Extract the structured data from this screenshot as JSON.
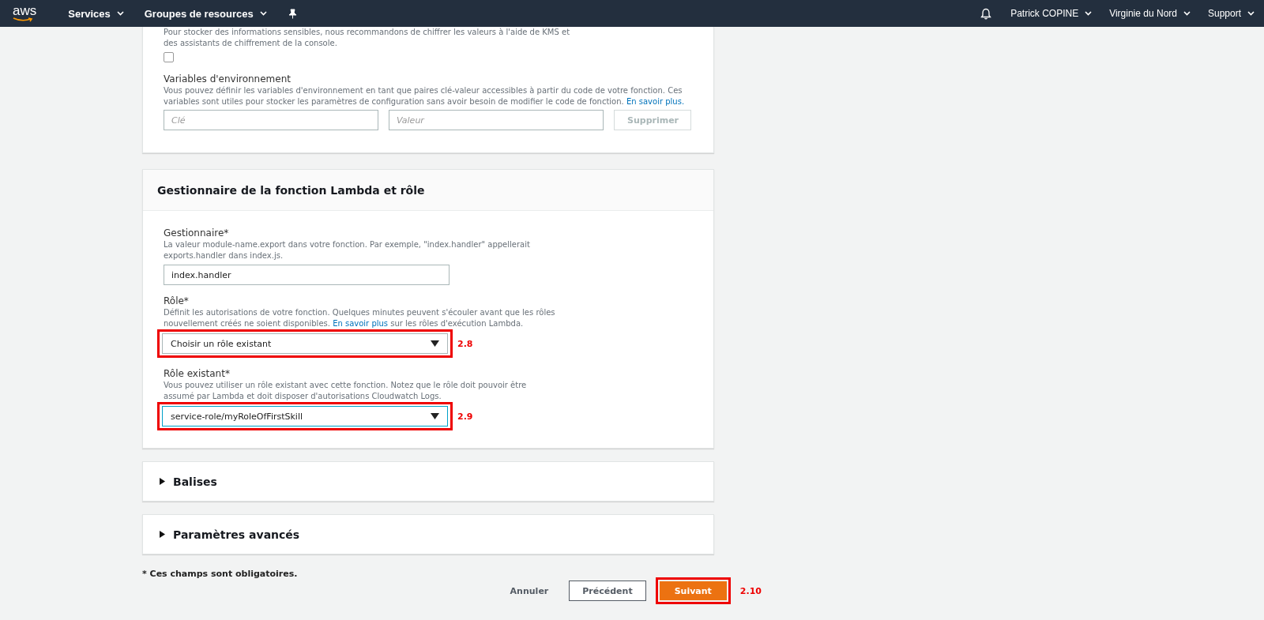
{
  "navbar": {
    "logo": "aws",
    "left_items": [
      {
        "label": "Services",
        "dropdown": true
      },
      {
        "label": "Groupes de resources",
        "dropdown": true
      }
    ],
    "right_items": [
      {
        "label": "Patrick COPINE",
        "dropdown": true
      },
      {
        "label": "Virginie du Nord",
        "dropdown": true
      },
      {
        "label": "Support",
        "dropdown": true
      }
    ]
  },
  "environment_card": {
    "encryption_note": [
      "Pour stocker des informations sensibles, nous recommandons de chiffrer les valeurs à l'aide de KMS et",
      "des assistants de chiffrement de la console."
    ],
    "encryption_checkbox": {
      "checked": false
    },
    "title": "Variables d'environnement",
    "description": "Vous pouvez définir les variables d'environnement en tant que paires clé-valeur accessibles à partir du code de votre fonction. Ces variables sont utiles pour stocker les paramètres de configuration sans avoir besoin de modifier le code de fonction.",
    "link": "En savoir plus.",
    "key_field": {
      "placeholder": "Clé"
    },
    "value_field": {
      "placeholder": "Valeur"
    },
    "delete_button": {
      "label": "Supprimer",
      "disabled": true
    }
  },
  "handler_card": {
    "title": "Gestionnaire de la fonction Lambda et rôle",
    "fields": [
      {
        "kind": "input",
        "label": "Gestionnaire*",
        "description": "La valeur module-name.export dans votre fonction. Par exemple, \"index.handler\" appellerait exports.handler dans index.js.",
        "value": "index.handler",
        "focused": false
      },
      {
        "kind": "select",
        "label": "Rôle*",
        "description": "Définit les autorisations de votre fonction. Quelques minutes peuvent s'écouler avant que les rôles nouvellement créés ne soient disponibles.",
        "link": "En savoir plus",
        "description_after": "sur les rôles d'exécution Lambda.",
        "value": "Choisir un rôle existant",
        "focused": false,
        "annotation": "2.8"
      },
      {
        "kind": "select",
        "label": "Rôle existant*",
        "description": "Vous pouvez utiliser un rôle existant avec cette fonction. Notez que le rôle doit pouvoir être assumé par Lambda et doit disposer d'autorisations Cloudwatch Logs.",
        "value": "service-role/myRoleOfFirstSkill",
        "focused": true,
        "annotation": "2.9"
      }
    ]
  },
  "collapsible_sections": [
    {
      "title": "Balises",
      "expanded": false
    },
    {
      "title": "Paramètres avancés",
      "expanded": false
    }
  ],
  "footer": {
    "note": "* Ces champs sont obligatoires.",
    "buttons": [
      {
        "kind": "link",
        "label": "Annuler"
      },
      {
        "kind": "secondary",
        "label": "Précédent"
      },
      {
        "kind": "primary",
        "label": "Suivant",
        "annotation": "2.10"
      }
    ]
  }
}
